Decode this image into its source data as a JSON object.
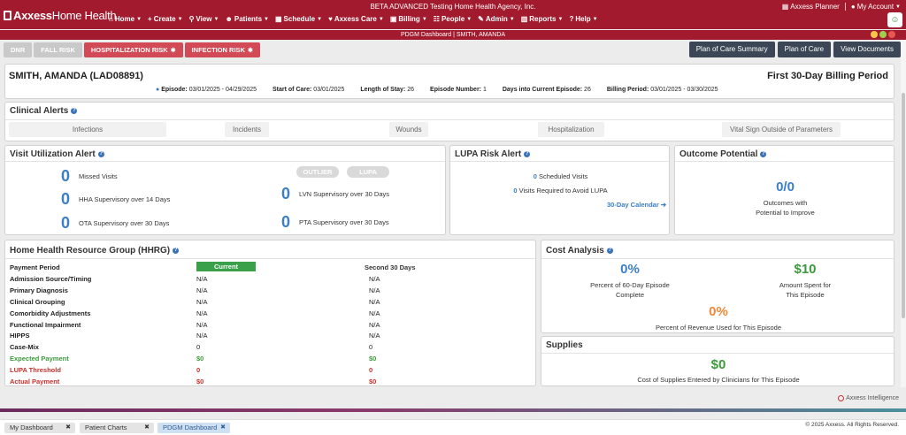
{
  "brand": {
    "name_bold": "Axxess",
    "name_thin": "Home Health"
  },
  "agency_title": "BETA ADVANCED Testing Home Health Agency, Inc.",
  "nav": [
    {
      "label": "Home",
      "icon": "home-icon",
      "glyph": "⌂"
    },
    {
      "label": "Create",
      "icon": "plus-icon",
      "glyph": "+"
    },
    {
      "label": "View",
      "icon": "search-icon",
      "glyph": "⚲"
    },
    {
      "label": "Patients",
      "icon": "person-icon",
      "glyph": "☻"
    },
    {
      "label": "Schedule",
      "icon": "calendar-icon",
      "glyph": "▦"
    },
    {
      "label": "Axxess Care",
      "icon": "heart-icon",
      "glyph": "♥"
    },
    {
      "label": "Billing",
      "icon": "billing-icon",
      "glyph": "▣"
    },
    {
      "label": "People",
      "icon": "people-icon",
      "glyph": "☷"
    },
    {
      "label": "Admin",
      "icon": "wrench-icon",
      "glyph": "✎"
    },
    {
      "label": "Reports",
      "icon": "chart-icon",
      "glyph": "▥"
    },
    {
      "label": "Help",
      "icon": "question-icon",
      "glyph": "?"
    }
  ],
  "account": {
    "planner": "Axxess Planner",
    "my_account": "My Account"
  },
  "window_title": "PDGM Dashboard | SMITH, AMANDA",
  "tabs": [
    {
      "label": "DNR",
      "style": "grey"
    },
    {
      "label": "FALL RISK",
      "style": "grey"
    },
    {
      "label": "HOSPITALIZATION RISK",
      "style": "red"
    },
    {
      "label": "INFECTION RISK",
      "style": "red"
    }
  ],
  "actions": [
    "Plan of Care Summary",
    "Plan of Care",
    "View Documents"
  ],
  "patient": {
    "name": "SMITH, AMANDA (LAD08891)",
    "period_title": "First 30-Day Billing Period",
    "episode_label": "Episode:",
    "episode_value": "03/01/2025 - 04/29/2025",
    "soc_label": "Start of Care:",
    "soc_value": "03/01/2025",
    "los_label": "Length of Stay:",
    "los_value": "26",
    "epnum_label": "Episode Number:",
    "epnum_value": "1",
    "days_label": "Days into Current Episode:",
    "days_value": "26",
    "bp_label": "Billing Period:",
    "bp_value": "03/01/2025 - 03/30/2025"
  },
  "clinical_alerts": {
    "title": "Clinical Alerts",
    "chips": [
      "Infections",
      "Incidents",
      "Wounds",
      "Hospitalization",
      "Vital Sign Outside of Parameters"
    ]
  },
  "visit_util": {
    "title": "Visit Utilization Alert",
    "outlier": "OUTLIER",
    "lupa": "LUPA",
    "items": [
      {
        "value": "0",
        "label": "Missed Visits"
      },
      {
        "value": "0",
        "label": "HHA Supervisory over 14 Days"
      },
      {
        "value": "0",
        "label": "OTA Supervisory over 30 Days"
      },
      {
        "value": "0",
        "label": "LVN Supervisory over 30 Days"
      },
      {
        "value": "0",
        "label": "PTA Supervisory over 30 Days"
      }
    ]
  },
  "lupa_risk": {
    "title": "LUPA Risk Alert",
    "scheduled_value": "0",
    "scheduled_label": "Scheduled Visits",
    "required_value": "0",
    "required_label": "Visits Required to Avoid LUPA",
    "calendar_link": "30-Day Calendar"
  },
  "outcome": {
    "title": "Outcome Potential",
    "value": "0/0",
    "label_line1": "Outcomes with",
    "label_line2": "Potential to Improve"
  },
  "hhrg": {
    "title": "Home Health Resource Group (HHRG)",
    "col_current": "Current",
    "col_second": "Second 30 Days",
    "rows": [
      {
        "k": "Payment Period",
        "c1": "",
        "c2": ""
      },
      {
        "k": "Admission Source/Timing",
        "c1": "N/A",
        "c2": "N/A"
      },
      {
        "k": "Primary Diagnosis",
        "c1": "N/A",
        "c2": "N/A"
      },
      {
        "k": "Clinical Grouping",
        "c1": "N/A",
        "c2": "N/A"
      },
      {
        "k": "Comorbidity Adjustments",
        "c1": "N/A",
        "c2": "N/A"
      },
      {
        "k": "Functional Impairment",
        "c1": "N/A",
        "c2": "N/A"
      },
      {
        "k": "HIPPS",
        "c1": "N/A",
        "c2": "N/A"
      },
      {
        "k": "Case-Mix",
        "c1": "0",
        "c2": "0"
      },
      {
        "k": "Expected Payment",
        "c1": "$0",
        "c2": "$0"
      },
      {
        "k": "LUPA Threshold",
        "c1": "0",
        "c2": "0"
      },
      {
        "k": "Actual Payment",
        "c1": "$0",
        "c2": "$0"
      }
    ]
  },
  "cost": {
    "title": "Cost Analysis",
    "pct_complete": "0%",
    "pct_complete_l1": "Percent of 60-Day Episode",
    "pct_complete_l2": "Complete",
    "spent": "$10",
    "spent_l1": "Amount Spent for",
    "spent_l2": "This Episode",
    "revenue": "0%",
    "revenue_l": "Percent of Revenue Used for This Episode"
  },
  "supplies": {
    "title": "Supplies",
    "value": "$0",
    "label": "Cost of Supplies Entered by Clinicians for This Episode"
  },
  "footer": {
    "ai_label": "Axxess Intelligence",
    "tasks": [
      "My Dashboard",
      "Patient Charts",
      "PDGM Dashboard"
    ],
    "copyright": "© 2025 Axxess. All Rights Reserved."
  },
  "colors": {
    "brand": "#a21a2e",
    "accent_blue": "#3a7fc8",
    "green": "#3b9a3b",
    "orange": "#f08a3b",
    "red": "#c5312c"
  }
}
